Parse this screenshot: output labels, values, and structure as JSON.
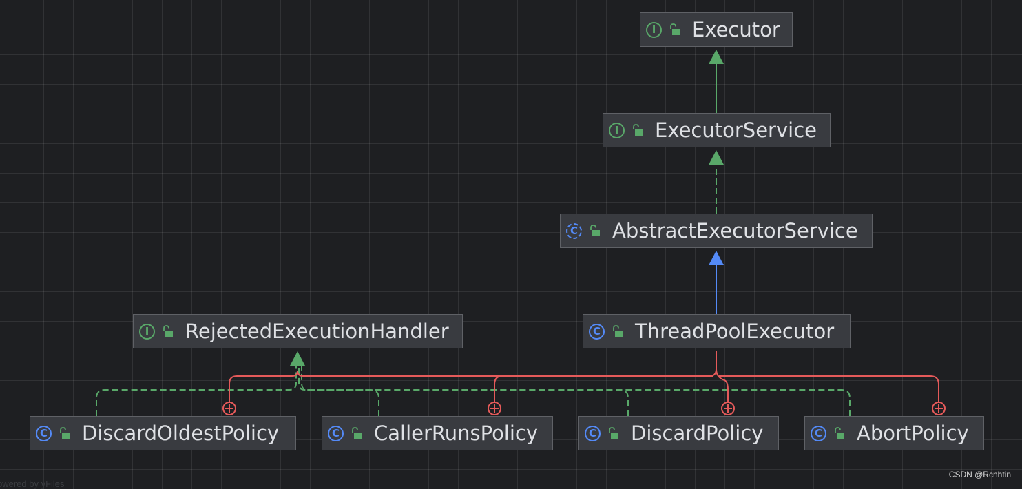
{
  "nodes": [
    {
      "name": "Executor",
      "kind": "interface",
      "kind_letter": "I"
    },
    {
      "name": "ExecutorService",
      "kind": "interface",
      "kind_letter": "I"
    },
    {
      "name": "AbstractExecutorService",
      "kind": "abstract-class",
      "kind_letter": "C"
    },
    {
      "name": "ThreadPoolExecutor",
      "kind": "class",
      "kind_letter": "C"
    },
    {
      "name": "RejectedExecutionHandler",
      "kind": "interface",
      "kind_letter": "I"
    },
    {
      "name": "DiscardOldestPolicy",
      "kind": "class",
      "kind_letter": "C"
    },
    {
      "name": "CallerRunsPolicy",
      "kind": "class",
      "kind_letter": "C"
    },
    {
      "name": "DiscardPolicy",
      "kind": "class",
      "kind_letter": "C"
    },
    {
      "name": "AbortPolicy",
      "kind": "class",
      "kind_letter": "C"
    }
  ],
  "edges": [
    {
      "from": "ExecutorService",
      "to": "Executor",
      "type": "extends-interface",
      "color": "#59a869"
    },
    {
      "from": "AbstractExecutorService",
      "to": "ExecutorService",
      "type": "implements",
      "color": "#59a869"
    },
    {
      "from": "ThreadPoolExecutor",
      "to": "AbstractExecutorService",
      "type": "extends",
      "color": "#548af7"
    },
    {
      "from": "DiscardOldestPolicy",
      "to": "RejectedExecutionHandler",
      "type": "implements",
      "color": "#59a869"
    },
    {
      "from": "CallerRunsPolicy",
      "to": "RejectedExecutionHandler",
      "type": "implements",
      "color": "#59a869"
    },
    {
      "from": "DiscardPolicy",
      "to": "RejectedExecutionHandler",
      "type": "implements",
      "color": "#59a869"
    },
    {
      "from": "AbortPolicy",
      "to": "RejectedExecutionHandler",
      "type": "implements",
      "color": "#59a869"
    },
    {
      "from": "ThreadPoolExecutor",
      "to": "DiscardOldestPolicy",
      "type": "inner-class",
      "color": "#e55a5a"
    },
    {
      "from": "ThreadPoolExecutor",
      "to": "CallerRunsPolicy",
      "type": "inner-class",
      "color": "#e55a5a"
    },
    {
      "from": "ThreadPoolExecutor",
      "to": "DiscardPolicy",
      "type": "inner-class",
      "color": "#e55a5a"
    },
    {
      "from": "ThreadPoolExecutor",
      "to": "AbortPolicy",
      "type": "inner-class",
      "color": "#e55a5a"
    }
  ],
  "colors": {
    "background": "#1e1f22",
    "node_fill": "#393b40",
    "interface": "#59a869",
    "class": "#548af7",
    "inner_class_link": "#e55a5a"
  },
  "visibility_icon": "unlocked-padlock-icon",
  "watermark": "CSDN @Rcnhtin",
  "footer_faded": "owered by yFiles"
}
